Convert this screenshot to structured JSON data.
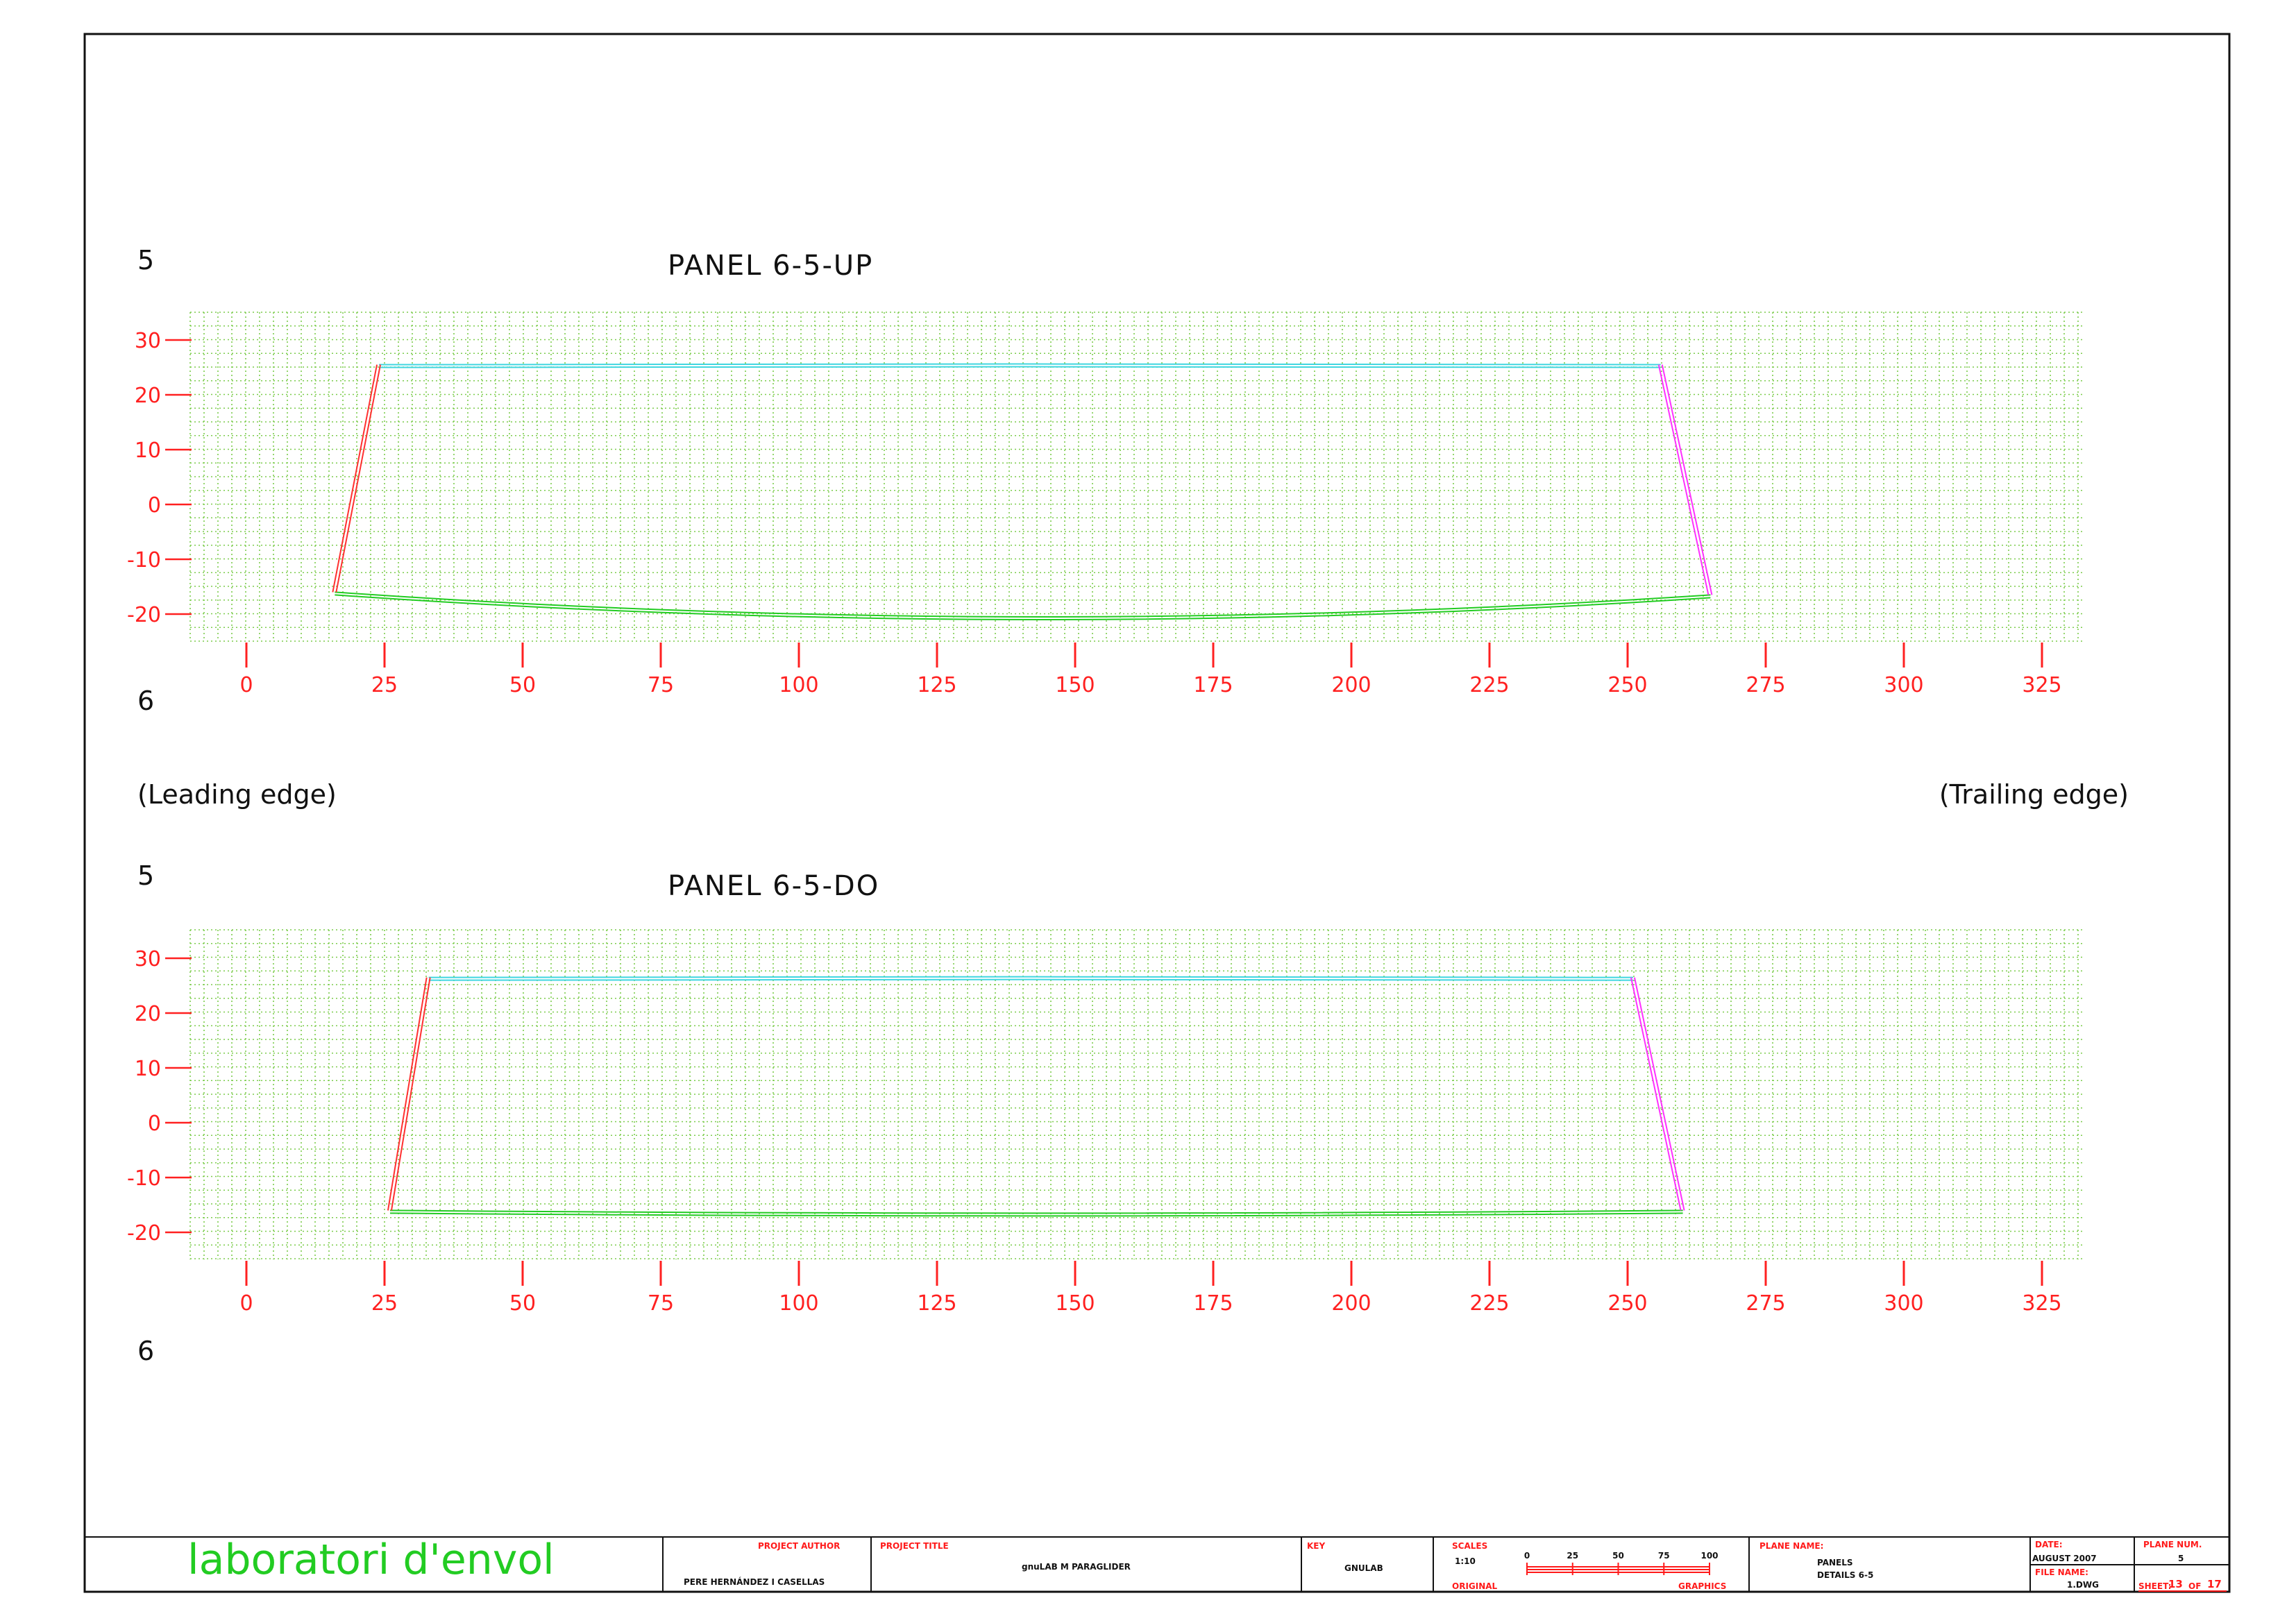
{
  "colors": {
    "frame": "#111111",
    "grid": "#7ccc4c",
    "axis": "#ff2020",
    "leading_edge": "#ff3030",
    "trailing_edge": "#ff30ff",
    "top_edge": "#3fd6e0",
    "bottom_edge": "#22cc22",
    "logo": "#22cc22"
  },
  "sheet_labels": {
    "leading_edge": "(Leading edge)",
    "trailing_edge": "(Trailing edge)"
  },
  "panels": [
    {
      "title": "PANEL 6-5-UP",
      "rib_top": "5",
      "rib_bottom": "6",
      "x_ticks": [
        "0",
        "25",
        "50",
        "75",
        "100",
        "125",
        "150",
        "175",
        "200",
        "225",
        "250",
        "275",
        "300",
        "325"
      ],
      "y_ticks": [
        "30",
        "20",
        "10",
        "0",
        "-10",
        "-20"
      ],
      "outline": {
        "top_y": 25.5,
        "bottom_y_start": -16,
        "bottom_y_mid": -20.5,
        "bottom_y_end": -16.5,
        "top_left_x": 24,
        "top_right_x": 256,
        "bottom_left_x": 16,
        "bottom_right_x": 265
      }
    },
    {
      "title": "PANEL 6-5-DO",
      "rib_top": "5",
      "rib_bottom": "6",
      "x_ticks": [
        "0",
        "25",
        "50",
        "75",
        "100",
        "125",
        "150",
        "175",
        "200",
        "225",
        "250",
        "275",
        "300",
        "325"
      ],
      "y_ticks": [
        "30",
        "20",
        "10",
        "0",
        "-10",
        "-20"
      ],
      "outline": {
        "top_y": 26.5,
        "bottom_y_start": -16,
        "bottom_y_mid": -16.5,
        "bottom_y_end": -16,
        "top_left_x": 33,
        "top_right_x": 251,
        "bottom_left_x": 26,
        "bottom_right_x": 260
      }
    }
  ],
  "title_block": {
    "logo": "laboratori d'envol",
    "author_label": "PROJECT AUTHOR",
    "author": "PERE HERNÁNDEZ I CASELLAS",
    "project_label": "PROJECT TITLE",
    "project": "gnuLAB M PARAGLIDER",
    "key_label": "KEY",
    "key": "GNULAB",
    "scales_label": "SCALES",
    "scale": "1:10",
    "scale_ticks": [
      "0",
      "25",
      "50",
      "75",
      "100"
    ],
    "original_label": "ORIGINAL",
    "graphics_label": "GRAPHICS",
    "plane_name_label": "PLANE NAME:",
    "plane_name_1": "PANELS",
    "plane_name_2": "DETAILS 6-5",
    "date_label": "DATE:",
    "date": "AUGUST 2007",
    "plane_num_label": "PLANE NUM.",
    "plane_num": "5",
    "file_name_label": "FILE NAME:",
    "file_name": "1.DWG",
    "sheet_label": "SHEET:",
    "sheet": "13",
    "of_label": "OF",
    "sheet_total": "17"
  }
}
